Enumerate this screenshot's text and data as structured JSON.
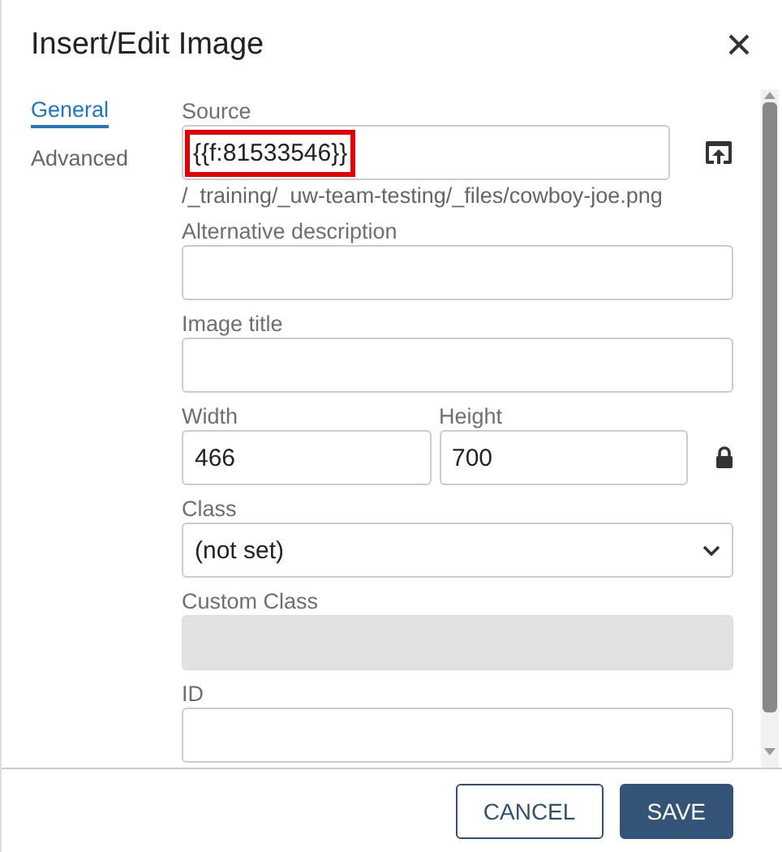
{
  "dialog": {
    "title": "Insert/Edit Image"
  },
  "tabs": [
    {
      "label": "General",
      "selected": true
    },
    {
      "label": "Advanced",
      "selected": false
    }
  ],
  "source": {
    "label": "Source",
    "value": "{{f:81533546}}",
    "highlighted": true,
    "path": "/_training/_uw-team-testing/_files/cowboy-joe.png"
  },
  "fields_top": [
    {
      "label": "Alternative description",
      "disabled": false
    },
    {
      "label": "Image title",
      "disabled": false
    }
  ],
  "size": {
    "width": {
      "label": "Width",
      "value": "466"
    },
    "height": {
      "label": "Height",
      "value": "700"
    },
    "locked": true
  },
  "class_select": {
    "label": "Class",
    "value": "(not set)"
  },
  "fields_bottom": [
    {
      "label": "Custom Class",
      "disabled": true
    },
    {
      "label": "ID",
      "disabled": false
    }
  ],
  "buttons": [
    {
      "label": "CANCEL",
      "kind": "secondary"
    },
    {
      "label": "SAVE",
      "kind": "primary"
    }
  ]
}
